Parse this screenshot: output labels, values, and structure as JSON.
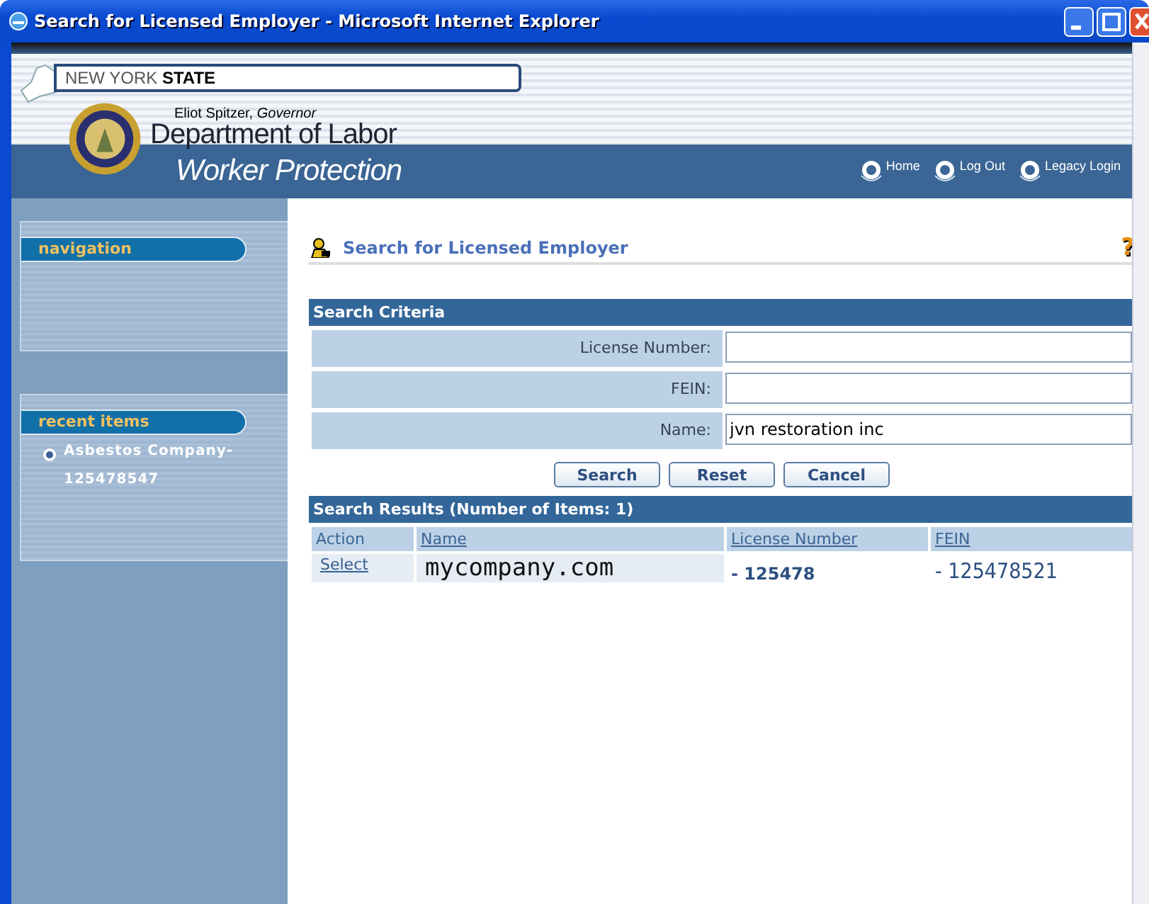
{
  "window": {
    "title": "Search for Licensed Employer - Microsoft Internet Explorer"
  },
  "header": {
    "state_name": "NEW YORK",
    "state_name_bold": "STATE",
    "governor": "Eliot Spitzer,",
    "governor_title": "Governor",
    "department": "Department of Labor",
    "division": "Worker Protection",
    "links": [
      "Home",
      "Log Out",
      "Legacy Login"
    ]
  },
  "sidebar": {
    "sections": [
      {
        "title": "navigation"
      },
      {
        "title": "recent items",
        "items": [
          "Asbestos Company-125478547"
        ]
      }
    ]
  },
  "page": {
    "title": "Search for Licensed Employer",
    "help": "?",
    "criteria": {
      "heading": "Search Criteria",
      "fields": [
        {
          "label": "License Number:"
        },
        {
          "label": "FEIN:"
        },
        {
          "label": "Name:",
          "value": "jvn restoration inc"
        }
      ]
    },
    "buttons": [
      "Search",
      "Reset",
      "Cancel"
    ],
    "results": {
      "heading": "Search Results (Number of Items: 1)",
      "columns": [
        "Action",
        "Name",
        "License Number",
        "FEIN"
      ],
      "rows": [
        {
          "action": "Select",
          "name": "mycompany.com",
          "license_number": "- 125478",
          "fein": "- 125478521"
        }
      ]
    }
  }
}
